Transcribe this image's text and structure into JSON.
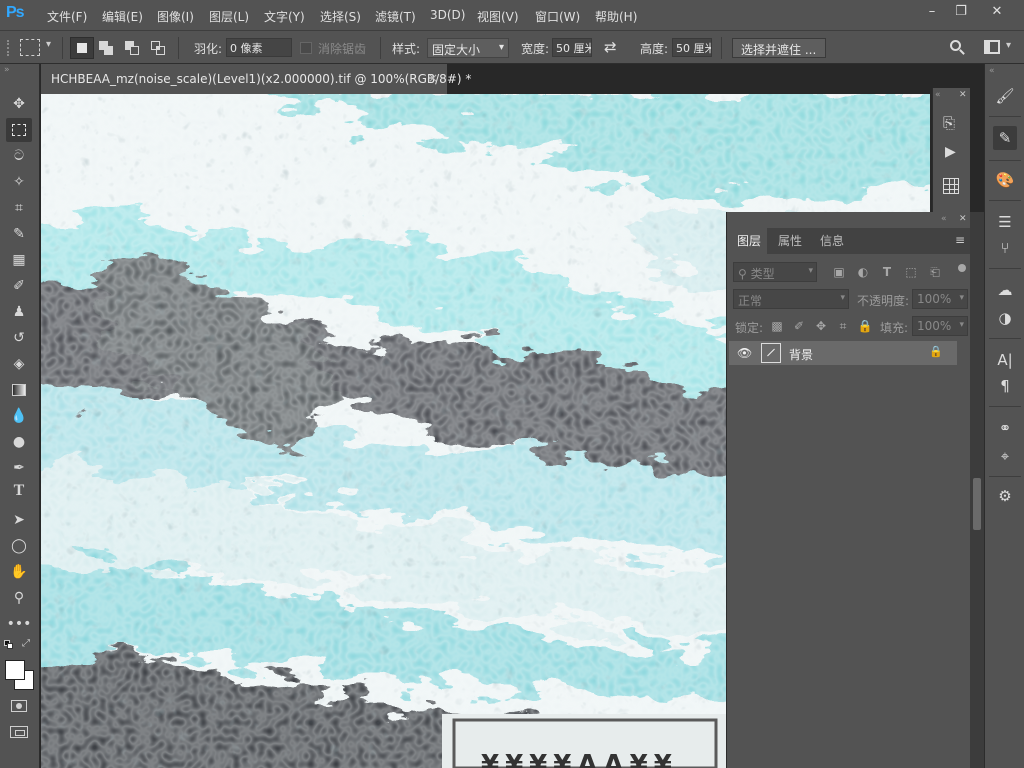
{
  "app": {
    "logo": "Ps"
  },
  "menu": [
    "文件(F)",
    "编辑(E)",
    "图像(I)",
    "图层(L)",
    "文字(Y)",
    "选择(S)",
    "滤镜(T)",
    "3D(D)",
    "视图(V)",
    "窗口(W)",
    "帮助(H)"
  ],
  "window_controls": {
    "minimize": "–",
    "restore": "❐",
    "close": "✕"
  },
  "options": {
    "feather_label": "羽化:",
    "feather_value": "0 像素",
    "antialias_label": "消除锯齿",
    "style_label": "样式:",
    "style_value": "固定大小",
    "width_label": "宽度:",
    "width_value": "50 厘米",
    "height_label": "高度:",
    "height_value": "50 厘米",
    "select_mask_button": "选择并遮住 ..."
  },
  "document": {
    "tab_title": "HCHBEAA_mz(noise_scale)(Level1)(x2.000000).tif @ 100%(RGB/8#) *",
    "close": "×"
  },
  "canvas_overlay_text": "¥¥¥¥AA¥¥",
  "layers_panel": {
    "tabs": [
      "图层",
      "属性",
      "信息"
    ],
    "filter_label": "类型",
    "blend_mode": "正常",
    "opacity_label": "不透明度:",
    "opacity_value": "100%",
    "lock_label": "锁定:",
    "fill_label": "填充:",
    "fill_value": "100%",
    "layers": [
      {
        "name": "背景",
        "visible": true,
        "locked": true
      }
    ]
  },
  "colors": {
    "chrome": "#535353",
    "panel_dark": "#424242",
    "accent": "#31a8ff"
  }
}
